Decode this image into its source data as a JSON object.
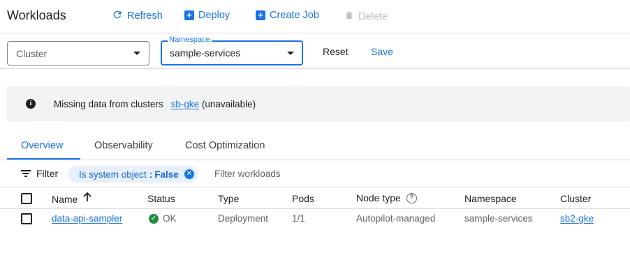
{
  "header": {
    "title": "Workloads",
    "actions": [
      {
        "label": "Refresh",
        "icon": "refresh-icon",
        "enabled": true
      },
      {
        "label": "Deploy",
        "icon": "add-box-icon",
        "enabled": true
      },
      {
        "label": "Create Job",
        "icon": "add-box-icon",
        "enabled": true
      },
      {
        "label": "Delete",
        "icon": "trash-icon",
        "enabled": false
      }
    ]
  },
  "filters": {
    "cluster": {
      "placeholder": "Cluster",
      "value": ""
    },
    "namespace": {
      "label": "Namespace",
      "value": "sample-services"
    },
    "reset_label": "Reset",
    "save_label": "Save"
  },
  "banner": {
    "icon": "info-icon",
    "text_before": "Missing data from clusters",
    "cluster_link": "sb-gke",
    "text_after": "(unavailable)"
  },
  "tabs": [
    {
      "label": "Overview",
      "active": true
    },
    {
      "label": "Observability",
      "active": false
    },
    {
      "label": "Cost Optimization",
      "active": false
    }
  ],
  "filter_bar": {
    "filter_label": "Filter",
    "chip": {
      "key": "Is system object",
      "value": "False"
    },
    "placeholder": "Filter workloads"
  },
  "table": {
    "columns": {
      "name": "Name",
      "status": "Status",
      "type": "Type",
      "pods": "Pods",
      "node_type": "Node type",
      "namespace": "Namespace",
      "cluster": "Cluster"
    },
    "sort": {
      "column": "Name",
      "direction": "ascending"
    },
    "rows": [
      {
        "name": "data-api-sampler",
        "status": "OK",
        "type": "Deployment",
        "pods": "1/1",
        "node_type": "Autopilot-managed",
        "namespace": "sample-services",
        "cluster": "sb2-gke"
      }
    ]
  },
  "colors": {
    "accent": "#1a73e8",
    "status_ok": "#1e8e3e",
    "banner_bg": "#f1f3f4",
    "chip_bg": "#e8f0fe"
  }
}
